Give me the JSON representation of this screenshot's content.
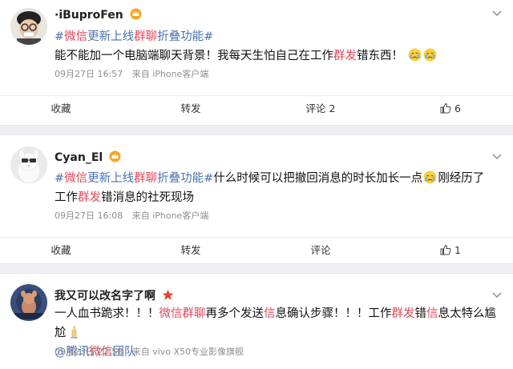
{
  "posts": [
    {
      "user": "·iBuproFen",
      "text_parts": [
        "#",
        "微信",
        "更新上线",
        "群聊",
        "折叠功能#",
        "能不能加一个电脑端聊天背景！我每天生怕自己在工作",
        "群发",
        "错东西！"
      ],
      "date": "09月27日 16:57",
      "source": "来自 iPhone客户端",
      "actions": {
        "fav": "收藏",
        "repost": "转发",
        "comment": "评论 2",
        "like": "6"
      }
    },
    {
      "user": "Cyan_El",
      "text_parts": [
        "#",
        "微信",
        "更新上线",
        "群聊",
        "折叠功能#",
        "什么时候可以把撤回消息的时长加长一点",
        "刚经历了工作",
        "群发",
        "错消息的社死现场"
      ],
      "date": "09月27日 16:08",
      "source": "来自 iPhone客户端",
      "actions": {
        "fav": "收藏",
        "repost": "转发",
        "comment": "评论",
        "like": "1"
      }
    },
    {
      "user": "我又可以改名字了啊",
      "text_parts": [
        "一人血书跪求！！！",
        "微信群聊",
        "再多个发送",
        "信",
        "息确认步骤！！！工作",
        "群发",
        "错",
        "信",
        "息太特么尴尬",
        "@腾讯",
        "微信",
        "团队"
      ],
      "date": "09月23日 22:58",
      "source": "来自 vivo X50专业影像旗舰"
    }
  ],
  "colors": {
    "hashtag": "#4a72b2",
    "highlight": "#e0475a",
    "meta": "#8e8e8e",
    "separator": "#eef0f3"
  },
  "icons": [
    "chevron-down-icon",
    "crown-badge-icon",
    "crying-emoji-icon",
    "like-icon",
    "star-badge-icon",
    "candle-emoji-icon"
  ]
}
